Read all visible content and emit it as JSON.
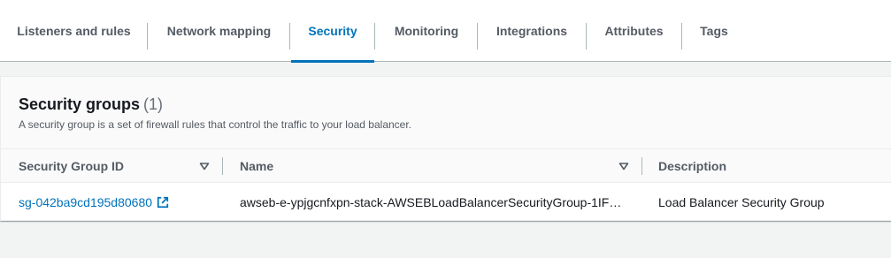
{
  "tabs": [
    {
      "label": "Listeners and rules"
    },
    {
      "label": "Network mapping"
    },
    {
      "label": "Security"
    },
    {
      "label": "Monitoring"
    },
    {
      "label": "Integrations"
    },
    {
      "label": "Attributes"
    },
    {
      "label": "Tags"
    }
  ],
  "active_tab": "Security",
  "security_groups": {
    "title": "Security groups",
    "count": "(1)",
    "description": "A security group is a set of firewall rules that control the traffic to your load balancer.",
    "columns": [
      {
        "label": "Security Group ID",
        "sortable": true
      },
      {
        "label": "Name",
        "sortable": true
      },
      {
        "label": "Description",
        "sortable": false
      }
    ],
    "rows": [
      {
        "id": "sg-042ba9cd195d80680",
        "name": "awseb-e-ypjgcnfxpn-stack-AWSEBLoadBalancerSecurityGroup-1IF…",
        "description": "Load Balancer Security Group"
      }
    ]
  },
  "colors": {
    "accent": "#0073bb",
    "tab_text": "#545b64",
    "background": "#f2f3f3"
  }
}
